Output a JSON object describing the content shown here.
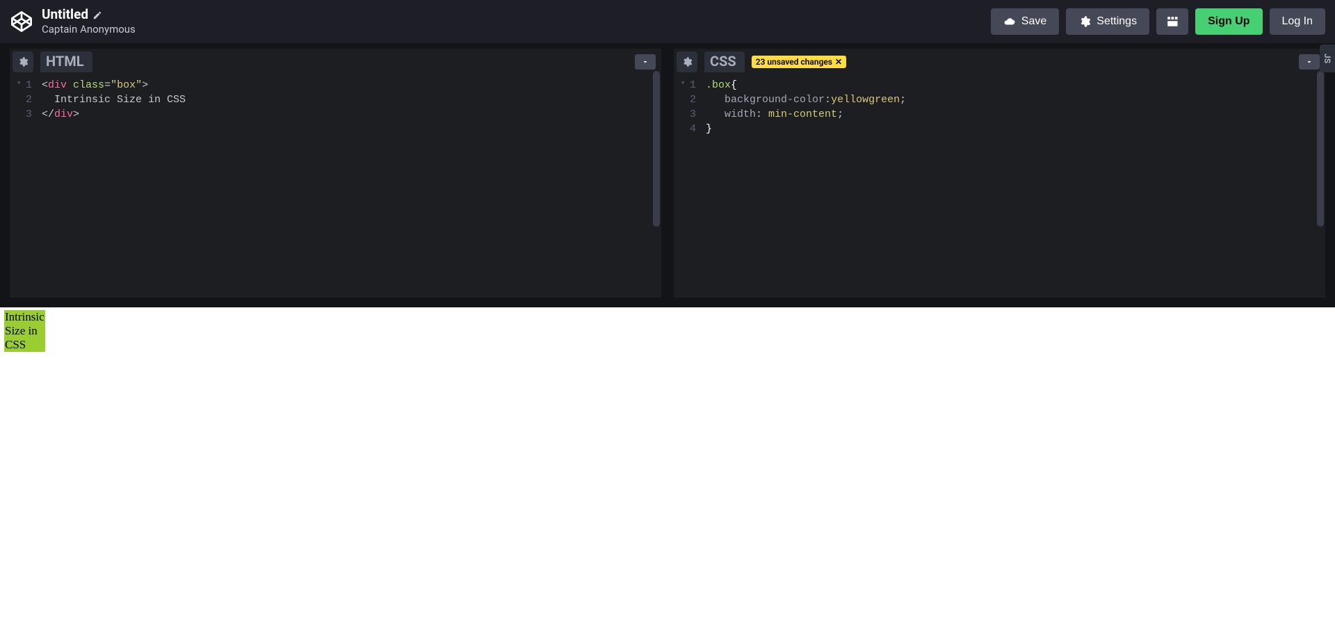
{
  "header": {
    "title": "Untitled",
    "author": "Captain Anonymous",
    "buttons": {
      "save": "Save",
      "settings": "Settings",
      "signup": "Sign Up",
      "login": "Log In"
    }
  },
  "panes": {
    "html": {
      "title": "HTML",
      "code": {
        "l1_open_tag": "div",
        "l1_attr": "class",
        "l1_attr_val": "\"box\"",
        "l2_text": "Intrinsic Size in CSS",
        "l3_close_tag": "div"
      }
    },
    "css": {
      "title": "CSS",
      "badge_text": "23 unsaved changes",
      "code": {
        "l1_sel": ".box",
        "l2_prop": "background-color",
        "l2_val": "yellowgreen",
        "l3_prop": "width",
        "l3_val": "min-content"
      }
    },
    "js": {
      "tab_label": "JS"
    }
  },
  "preview": {
    "box_text": "Intrinsic Size in CSS"
  }
}
